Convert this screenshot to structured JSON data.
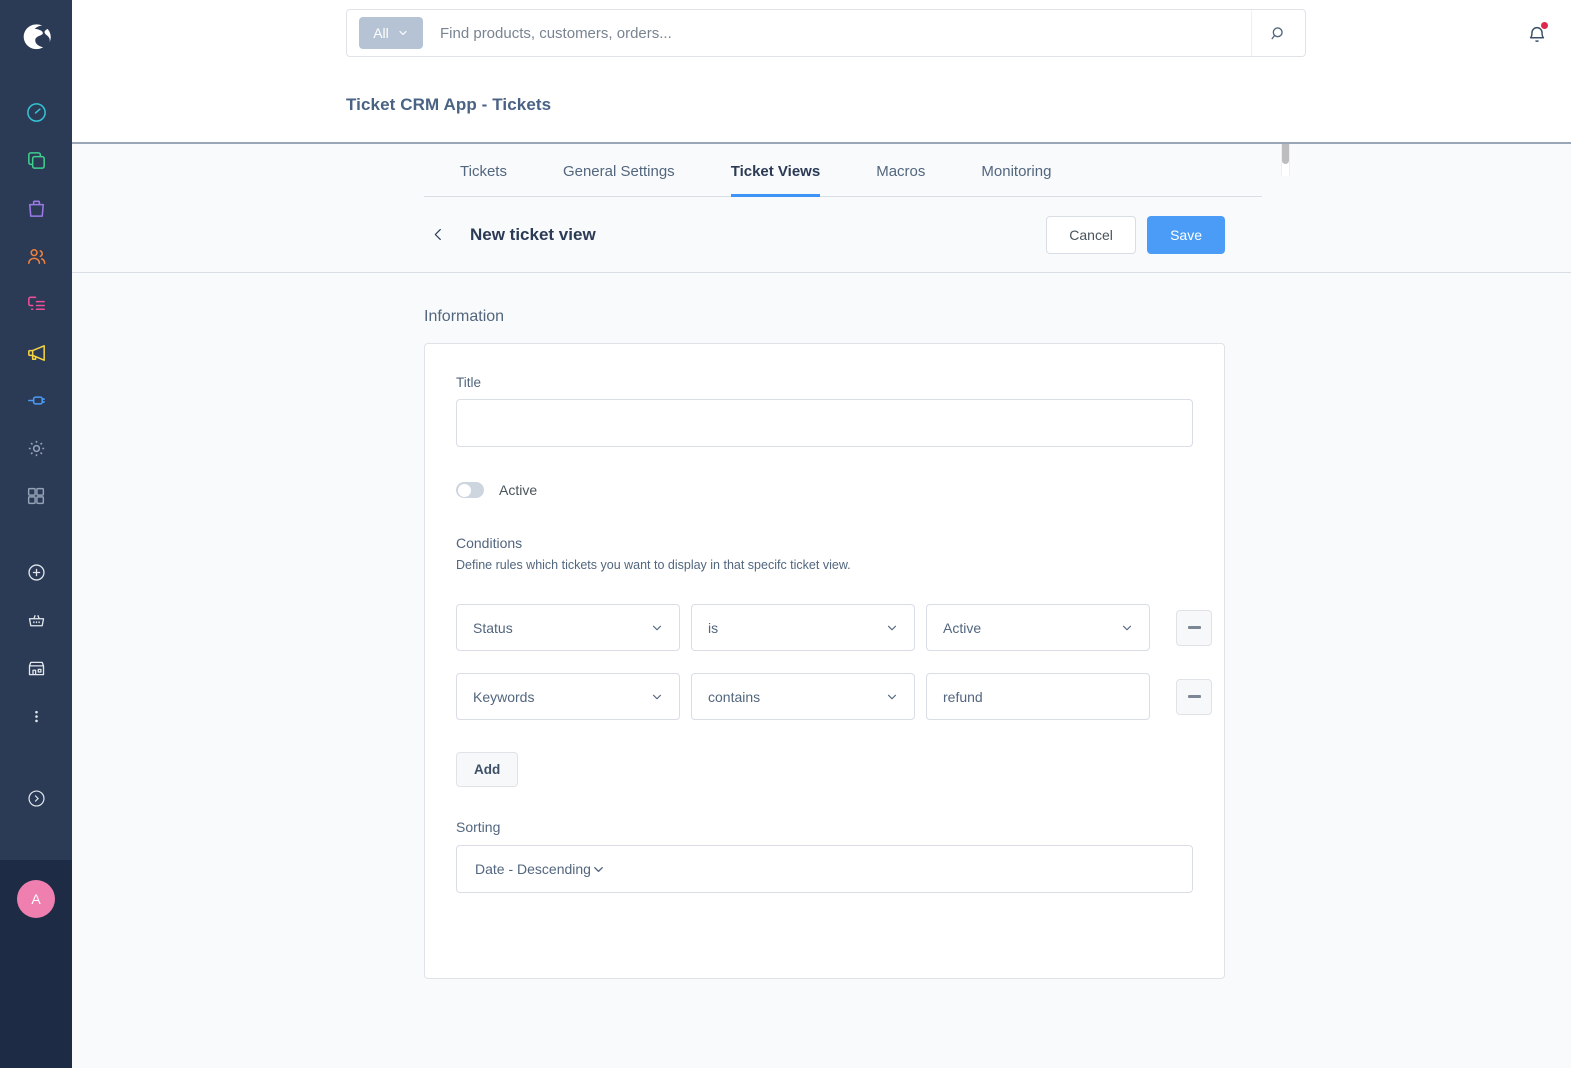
{
  "sidebar": {
    "logo_name": "shopware-logo",
    "avatar_initial": "A",
    "items": [
      {
        "name": "dashboard-icon",
        "color": "#34c3d4"
      },
      {
        "name": "catalogues-icon",
        "color": "#3ecf8e"
      },
      {
        "name": "orders-icon",
        "color": "#9b7ae8"
      },
      {
        "name": "customers-icon",
        "color": "#f0813c"
      },
      {
        "name": "content-icon",
        "color": "#ed4f98"
      },
      {
        "name": "marketing-icon",
        "color": "#f5d442"
      },
      {
        "name": "extensions-icon",
        "color": "#4a9cf7"
      },
      {
        "name": "settings-icon",
        "color": "#94a2b5"
      },
      {
        "name": "apps-icon",
        "color": "#94a2b5"
      }
    ],
    "utility_items": [
      {
        "name": "add-icon"
      },
      {
        "name": "basket-icon"
      },
      {
        "name": "storefront-icon"
      },
      {
        "name": "more-options-icon"
      },
      {
        "name": "expand-sidebar-icon"
      }
    ]
  },
  "topbar": {
    "search_scope_label": "All",
    "search_placeholder": "Find products, customers, orders...",
    "search_value": "",
    "search_icon": "search-icon",
    "notification_icon": "bell-icon",
    "notification_has_badge": true
  },
  "header": {
    "page_title": "Ticket CRM App - Tickets"
  },
  "tabs": {
    "items": [
      {
        "label": "Tickets",
        "active": false
      },
      {
        "label": "General Settings",
        "active": false
      },
      {
        "label": "Ticket Views",
        "active": true
      },
      {
        "label": "Macros",
        "active": false
      },
      {
        "label": "Monitoring",
        "active": false
      }
    ],
    "active_color": "#3d94f6"
  },
  "subheader": {
    "back_icon": "chevron-left-icon",
    "title": "New ticket view",
    "cancel_label": "Cancel",
    "save_label": "Save",
    "save_color": "#4a9cf7"
  },
  "form": {
    "section_label": "Information",
    "title_label": "Title",
    "title_value": "",
    "active_label": "Active",
    "active_on": false,
    "conditions_label": "Conditions",
    "conditions_description": "Define rules which tickets you want to display in that specifc ticket view.",
    "conditions": [
      {
        "field": "Status",
        "operator": "is",
        "value": "Active",
        "value_type": "select",
        "remove_icon": "minus-icon"
      },
      {
        "field": "Keywords",
        "operator": "contains",
        "value": "refund",
        "value_type": "text",
        "remove_icon": "minus-icon"
      }
    ],
    "add_label": "Add",
    "sorting_label": "Sorting",
    "sorting_value": "Date - Descending"
  }
}
